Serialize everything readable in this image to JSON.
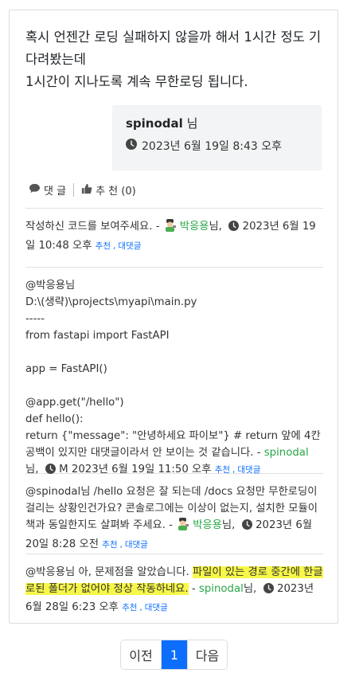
{
  "question": {
    "line1": "혹시 언젠간 로딩 실패하지 않을까 해서 1시간 정도 기다려봤는데",
    "line2": "1시간이 지나도록 계속 무한로딩 됩니다."
  },
  "author": {
    "name": "spinodal",
    "suffix": " 님",
    "date": "2023년 6월 19일 8:43 오후"
  },
  "actions": {
    "comment_label": "댓 글",
    "recommend_label": "추 천 (0)"
  },
  "comments": [
    {
      "text": "작성하신 코드를 보여주세요. - ",
      "author": "박응용",
      "author_suffix": "님,",
      "date": "2023년 6월 19일 10:48 오후",
      "recommend": "추천",
      "reply": "대댓글"
    },
    {
      "lines": [
        "@박응용님",
        "D:\\(생략)\\projects\\myapi\\main.py",
        "-----",
        "from fastapi import FastAPI",
        "",
        "app = FastAPI()",
        "",
        "@app.get(\"/hello\")",
        "def hello():",
        "return {\"message\": \"안녕하세요 파이보\"} # return 앞에 4칸 공백이 있지만 대댓글이라서 안 보이는 것 같습니다. - "
      ],
      "author": "spinodal",
      "author_suffix": "님,",
      "date": "M 2023년 6월 19일 11:50 오후",
      "recommend": "추천",
      "reply": "대댓글"
    },
    {
      "mention": "@spinodal",
      "text": "님 /hello 요청은 잘 되는데 /docs 요청만 무한로딩이 걸리는 상황인건가요? 콘솔로그에는 이상이 없는지, 설치한 모듈이 책과 동일한지도 살펴봐 주세요. - ",
      "author": "박응용",
      "author_suffix": "님,",
      "date": "2023년 6월 20일 8:28 오전",
      "recommend": "추천",
      "reply": "대댓글"
    },
    {
      "text": "@박응용님 아, 문제점을 알았습니다. ",
      "highlight": "파일이 있는 경로 중간에 한글로된 폴더가 없어야 정상 작동하네요.",
      "dash": " - ",
      "author": "spinodal",
      "author_suffix": "님,",
      "date": "2023년 6월 28일 6:23 오후",
      "recommend": "추천",
      "reply": "대댓글"
    }
  ],
  "separator": ",",
  "pagination": {
    "prev": "이전",
    "current": "1",
    "next": "다음"
  },
  "colors": {
    "accent": "#0d6efd",
    "author_green": "#28a745",
    "highlight": "#f7f74a"
  },
  "icons": [
    "clock-icon",
    "comment-icon",
    "thumbs-up-icon",
    "avatar-icon"
  ]
}
